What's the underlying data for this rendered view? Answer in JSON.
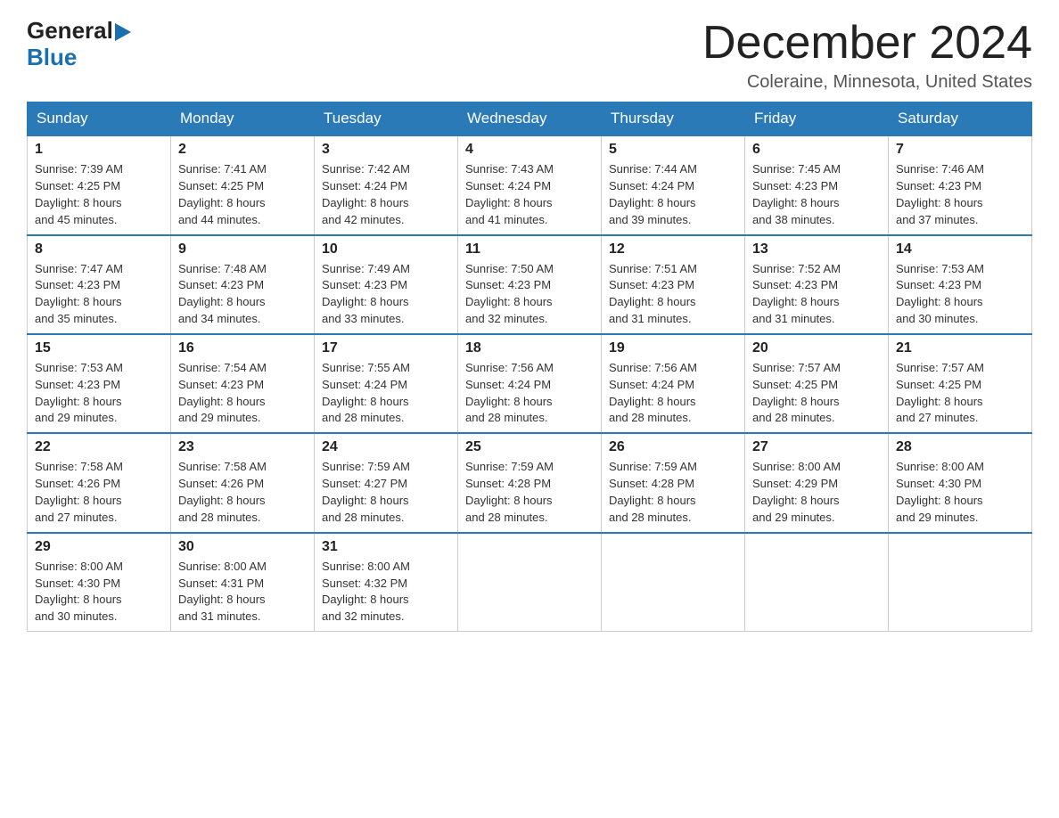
{
  "header": {
    "logo_general": "General",
    "logo_blue": "Blue",
    "month_title": "December 2024",
    "location": "Coleraine, Minnesota, United States"
  },
  "weekdays": [
    "Sunday",
    "Monday",
    "Tuesday",
    "Wednesday",
    "Thursday",
    "Friday",
    "Saturday"
  ],
  "weeks": [
    [
      {
        "day": "1",
        "sunrise": "7:39 AM",
        "sunset": "4:25 PM",
        "daylight": "8 hours and 45 minutes."
      },
      {
        "day": "2",
        "sunrise": "7:41 AM",
        "sunset": "4:25 PM",
        "daylight": "8 hours and 44 minutes."
      },
      {
        "day": "3",
        "sunrise": "7:42 AM",
        "sunset": "4:24 PM",
        "daylight": "8 hours and 42 minutes."
      },
      {
        "day": "4",
        "sunrise": "7:43 AM",
        "sunset": "4:24 PM",
        "daylight": "8 hours and 41 minutes."
      },
      {
        "day": "5",
        "sunrise": "7:44 AM",
        "sunset": "4:24 PM",
        "daylight": "8 hours and 39 minutes."
      },
      {
        "day": "6",
        "sunrise": "7:45 AM",
        "sunset": "4:23 PM",
        "daylight": "8 hours and 38 minutes."
      },
      {
        "day": "7",
        "sunrise": "7:46 AM",
        "sunset": "4:23 PM",
        "daylight": "8 hours and 37 minutes."
      }
    ],
    [
      {
        "day": "8",
        "sunrise": "7:47 AM",
        "sunset": "4:23 PM",
        "daylight": "8 hours and 35 minutes."
      },
      {
        "day": "9",
        "sunrise": "7:48 AM",
        "sunset": "4:23 PM",
        "daylight": "8 hours and 34 minutes."
      },
      {
        "day": "10",
        "sunrise": "7:49 AM",
        "sunset": "4:23 PM",
        "daylight": "8 hours and 33 minutes."
      },
      {
        "day": "11",
        "sunrise": "7:50 AM",
        "sunset": "4:23 PM",
        "daylight": "8 hours and 32 minutes."
      },
      {
        "day": "12",
        "sunrise": "7:51 AM",
        "sunset": "4:23 PM",
        "daylight": "8 hours and 31 minutes."
      },
      {
        "day": "13",
        "sunrise": "7:52 AM",
        "sunset": "4:23 PM",
        "daylight": "8 hours and 31 minutes."
      },
      {
        "day": "14",
        "sunrise": "7:53 AM",
        "sunset": "4:23 PM",
        "daylight": "8 hours and 30 minutes."
      }
    ],
    [
      {
        "day": "15",
        "sunrise": "7:53 AM",
        "sunset": "4:23 PM",
        "daylight": "8 hours and 29 minutes."
      },
      {
        "day": "16",
        "sunrise": "7:54 AM",
        "sunset": "4:23 PM",
        "daylight": "8 hours and 29 minutes."
      },
      {
        "day": "17",
        "sunrise": "7:55 AM",
        "sunset": "4:24 PM",
        "daylight": "8 hours and 28 minutes."
      },
      {
        "day": "18",
        "sunrise": "7:56 AM",
        "sunset": "4:24 PM",
        "daylight": "8 hours and 28 minutes."
      },
      {
        "day": "19",
        "sunrise": "7:56 AM",
        "sunset": "4:24 PM",
        "daylight": "8 hours and 28 minutes."
      },
      {
        "day": "20",
        "sunrise": "7:57 AM",
        "sunset": "4:25 PM",
        "daylight": "8 hours and 28 minutes."
      },
      {
        "day": "21",
        "sunrise": "7:57 AM",
        "sunset": "4:25 PM",
        "daylight": "8 hours and 27 minutes."
      }
    ],
    [
      {
        "day": "22",
        "sunrise": "7:58 AM",
        "sunset": "4:26 PM",
        "daylight": "8 hours and 27 minutes."
      },
      {
        "day": "23",
        "sunrise": "7:58 AM",
        "sunset": "4:26 PM",
        "daylight": "8 hours and 28 minutes."
      },
      {
        "day": "24",
        "sunrise": "7:59 AM",
        "sunset": "4:27 PM",
        "daylight": "8 hours and 28 minutes."
      },
      {
        "day": "25",
        "sunrise": "7:59 AM",
        "sunset": "4:28 PM",
        "daylight": "8 hours and 28 minutes."
      },
      {
        "day": "26",
        "sunrise": "7:59 AM",
        "sunset": "4:28 PM",
        "daylight": "8 hours and 28 minutes."
      },
      {
        "day": "27",
        "sunrise": "8:00 AM",
        "sunset": "4:29 PM",
        "daylight": "8 hours and 29 minutes."
      },
      {
        "day": "28",
        "sunrise": "8:00 AM",
        "sunset": "4:30 PM",
        "daylight": "8 hours and 29 minutes."
      }
    ],
    [
      {
        "day": "29",
        "sunrise": "8:00 AM",
        "sunset": "4:30 PM",
        "daylight": "8 hours and 30 minutes."
      },
      {
        "day": "30",
        "sunrise": "8:00 AM",
        "sunset": "4:31 PM",
        "daylight": "8 hours and 31 minutes."
      },
      {
        "day": "31",
        "sunrise": "8:00 AM",
        "sunset": "4:32 PM",
        "daylight": "8 hours and 32 minutes."
      },
      null,
      null,
      null,
      null
    ]
  ],
  "labels": {
    "sunrise": "Sunrise:",
    "sunset": "Sunset:",
    "daylight": "Daylight:"
  }
}
